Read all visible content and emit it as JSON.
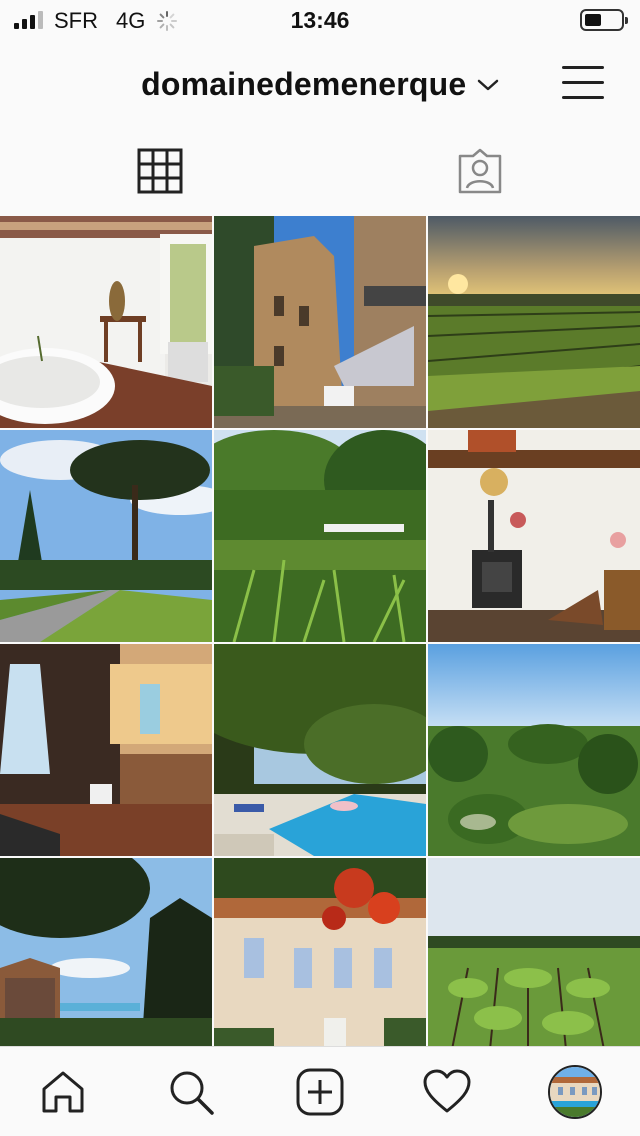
{
  "status_bar": {
    "carrier": "SFR",
    "network": "4G",
    "time": "13:46",
    "signal_bars_active": 3,
    "signal_bars_total": 4,
    "battery_level": 0.45
  },
  "header": {
    "username": "domainedemenerque",
    "chevron_icon": "chevron-down-icon",
    "menu_icon": "hamburger-menu-icon"
  },
  "tabs": [
    {
      "name": "grid",
      "icon": "grid-icon",
      "active": true
    },
    {
      "name": "tagged",
      "icon": "tagged-person-icon",
      "active": false
    }
  ],
  "posts": [
    {
      "subject": "bathroom"
    },
    {
      "subject": "village-street"
    },
    {
      "subject": "vineyard-sunset"
    },
    {
      "subject": "pine-trees-road"
    },
    {
      "subject": "garden-greenery"
    },
    {
      "subject": "wood-stove"
    },
    {
      "subject": "bathrobe-bathroom"
    },
    {
      "subject": "swimming-pool"
    },
    {
      "subject": "countryside-view"
    },
    {
      "subject": "pool-palm"
    },
    {
      "subject": "house-facade-flowers"
    },
    {
      "subject": "vineyard-rows"
    }
  ],
  "bottom_nav": [
    {
      "name": "home",
      "icon": "home-icon"
    },
    {
      "name": "search",
      "icon": "search-icon"
    },
    {
      "name": "new-post",
      "icon": "add-post-icon"
    },
    {
      "name": "activity",
      "icon": "heart-icon"
    },
    {
      "name": "profile",
      "icon": "profile-avatar"
    }
  ],
  "colors": {
    "background": "#fafafa",
    "icon": "#222222",
    "pool_blue": "#29a3d8",
    "sky_blue": "#6fb0e8"
  }
}
